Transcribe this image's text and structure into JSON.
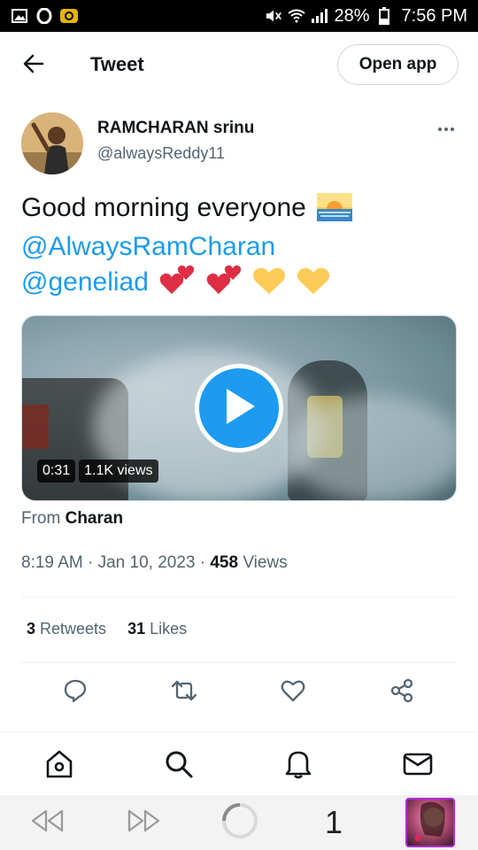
{
  "status_bar": {
    "battery_percent": "28%",
    "time": "7:56 PM"
  },
  "header": {
    "title": "Tweet",
    "open_app_label": "Open app"
  },
  "tweet": {
    "author_name": "RAMCHARAN srinu",
    "author_handle": "@alwaysReddy11",
    "text_line1": "Good morning everyone",
    "mention1": "@AlwaysRamCharan",
    "mention2": "@geneliad",
    "video": {
      "duration": "0:31",
      "views": "1.1K views"
    },
    "from_prefix": "From",
    "from_name": "Charan",
    "timestamp": "8:19 AM · Jan 10, 2023 · ",
    "views_count": "458",
    "views_label": " Views",
    "retweets_count": "3",
    "retweets_label": " Retweets",
    "likes_count": "31",
    "likes_label": " Likes"
  },
  "browser": {
    "tab_count": "1"
  },
  "colors": {
    "accent": "#1d9bf0",
    "text": "#0f1419",
    "muted": "#536471",
    "border": "#cfd9de"
  }
}
